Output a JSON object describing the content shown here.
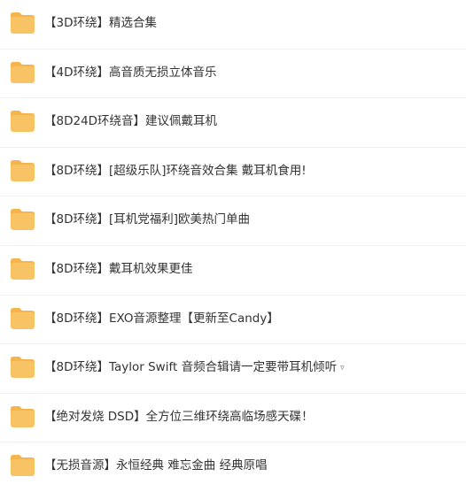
{
  "icon_color": "#f8c365",
  "icon_tab_color": "#f5b44c",
  "files": [
    {
      "name": "【3D环绕】精选合集",
      "icon": "folder-icon"
    },
    {
      "name": "【4D环绕】高音质无损立体音乐",
      "icon": "folder-icon"
    },
    {
      "name": "【8D24D环绕音】建议佩戴耳机",
      "icon": "folder-icon"
    },
    {
      "name": "【8D环绕】[超级乐队]环绕音效合集 戴耳机食用!",
      "icon": "folder-icon"
    },
    {
      "name": "【8D环绕】[耳机党福利]欧美热门单曲",
      "icon": "folder-icon"
    },
    {
      "name": "【8D环绕】戴耳机效果更佳",
      "icon": "folder-icon"
    },
    {
      "name": "【8D环绕】EXO音源整理【更新至Candy】",
      "icon": "folder-icon"
    },
    {
      "name": "【8D环绕】Taylor Swift 音频合辑请一定要带耳机倾听",
      "icon": "folder-icon",
      "suffix": "▿"
    },
    {
      "name": "【绝对发烧 DSD】全方位三维环绕高临场感天碟！",
      "icon": "folder-icon"
    },
    {
      "name": "【无损音源】永恒经典 难忘金曲 经典原唱",
      "icon": "folder-icon"
    }
  ]
}
